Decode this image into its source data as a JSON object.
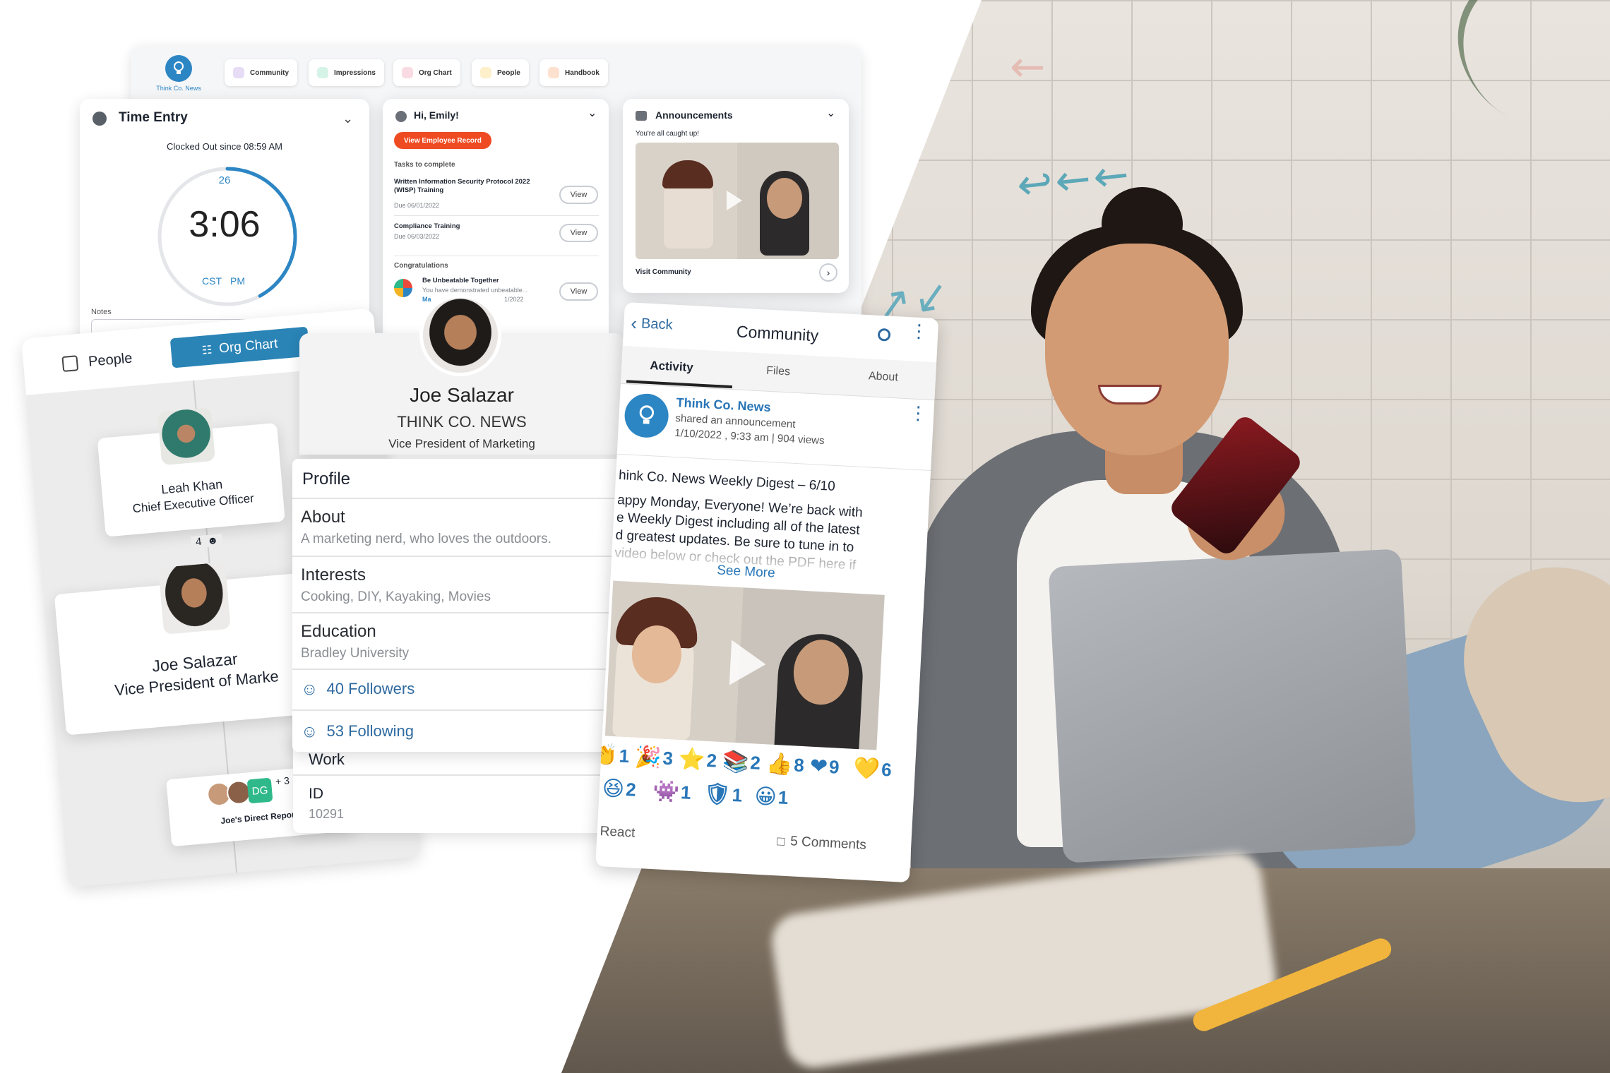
{
  "colors": {
    "accent_blue": "#2d86c4",
    "link_blue": "#2e6aa0",
    "orange_button": "#ef4b23",
    "teal_tab": "#2a84b6"
  },
  "dashboard": {
    "brand_label": "Think Co. News",
    "nav_items": [
      {
        "label": "Community",
        "icon": "community-icon",
        "color": "#9a6ad1"
      },
      {
        "label": "Impressions",
        "icon": "star-icon",
        "color": "#2fb98a"
      },
      {
        "label": "Org Chart",
        "icon": "org-chart-icon",
        "color": "#e3446c"
      },
      {
        "label": "People",
        "icon": "person-icon",
        "color": "#f2b324"
      },
      {
        "label": "Handbook",
        "icon": "book-icon",
        "color": "#f07a2a"
      }
    ]
  },
  "time_entry": {
    "title": "Time Entry",
    "status": "Clocked Out since 08:59 AM",
    "day": "26",
    "time": "3:06",
    "timezone": "CST",
    "meridiem": "PM",
    "progress": 0.42,
    "notes_label": "Notes"
  },
  "greeting": {
    "title": "Hi, Emily!",
    "button": "View Employee Record",
    "tasks_heading": "Tasks to complete",
    "tasks": [
      {
        "title": "Written Information Security Protocol 2022 (WISP) Training",
        "due": "Due 06/01/2022",
        "action": "View"
      },
      {
        "title": "Compliance Training",
        "due": "Due 06/03/2022",
        "action": "View"
      }
    ],
    "congrats_heading": "Congratulations",
    "congrats": {
      "title": "Be Unbeatable Together",
      "text": "You have demonstrated unbeatable...",
      "link": "Ma",
      "date": "1/2022",
      "action": "View"
    }
  },
  "announcements": {
    "title": "Announcements",
    "subtitle": "You're all caught up!",
    "footer": "Visit Community"
  },
  "people_panel": {
    "tab_people": "People",
    "tab_org_chart": "Org Chart",
    "ceo": {
      "name": "Leah Khan",
      "role": "Chief Executive Officer",
      "reports_count": "4"
    },
    "vp": {
      "name": "Joe Salazar",
      "role": "Vice President of Marke"
    },
    "direct_reports": {
      "initials": "DG",
      "extra": "+ 3",
      "label": "Joe's Direct Reports"
    }
  },
  "profile": {
    "name": "Joe Salazar",
    "company": "THINK CO. NEWS",
    "role": "Vice President of Marketing",
    "section_title": "Profile",
    "about_label": "About",
    "about_value": "A marketing nerd, who loves the outdoors.",
    "interests_label": "Interests",
    "interests_value": "Cooking, DIY, Kayaking, Movies",
    "education_label": "Education",
    "education_value": "Bradley University",
    "followers": "40 Followers",
    "following": "53 Following",
    "work_label": "Work",
    "id_label": "ID",
    "id_value": "10291"
  },
  "community": {
    "back": "Back",
    "title": "Community",
    "tabs": [
      "Activity",
      "Files",
      "About"
    ],
    "active_tab": "Activity",
    "post": {
      "author": "Think Co. News",
      "action": "shared an announcement",
      "meta": "1/10/2022 , 9:33 am | 904 views",
      "heading": "hink Co. News Weekly Digest – 6/10",
      "body_lines": [
        "appy Monday, Everyone! We’re back with",
        "e Weekly Digest including all of the latest",
        "d greatest updates. Be sure to tune in to",
        "video below or check out the PDF here if"
      ],
      "see_more": "See More"
    },
    "reactions_row1": [
      {
        "emoji": "👏",
        "count": "1"
      },
      {
        "emoji": "🎉",
        "count": "3"
      },
      {
        "emoji": "⭐",
        "count": "2"
      },
      {
        "emoji": "📚",
        "count": "2"
      },
      {
        "emoji": "👍",
        "count": "8"
      },
      {
        "emoji": "❤",
        "count": "9"
      },
      {
        "emoji": "💛",
        "count": "6"
      }
    ],
    "reactions_row2": [
      {
        "emoji": "😆",
        "count": "2"
      },
      {
        "emoji": "👾",
        "count": "1"
      },
      {
        "emoji": "🛡",
        "count": "1"
      },
      {
        "emoji": "😀",
        "count": "1"
      }
    ],
    "react_label": "React",
    "comments": "5 Comments"
  }
}
